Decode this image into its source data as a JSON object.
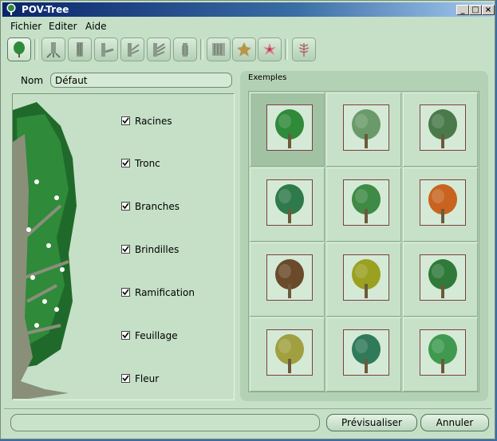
{
  "window": {
    "title": "POV-Tree"
  },
  "title_buttons": {
    "minimize": "_",
    "maximize": "□",
    "close": "×"
  },
  "menu": [
    {
      "label": "Fichier"
    },
    {
      "label": "Editer"
    },
    {
      "label": "Aide"
    }
  ],
  "toolbar": {
    "buttons": [
      {
        "icon": "tree-icon",
        "selected": true
      },
      {
        "icon": "roots-icon"
      },
      {
        "icon": "trunk-icon"
      },
      {
        "icon": "branches-icon"
      },
      {
        "icon": "twigs-icon"
      },
      {
        "icon": "ramification-icon"
      },
      {
        "icon": "trunk-texture-icon"
      },
      {
        "icon": "bark-icon"
      },
      {
        "icon": "leaf-icon"
      },
      {
        "icon": "flower-icon"
      },
      {
        "icon": "fern-icon"
      }
    ]
  },
  "name": {
    "label": "Nom",
    "value": "Défaut"
  },
  "components": [
    {
      "label": "Racines",
      "checked": true
    },
    {
      "label": "Tronc",
      "checked": true
    },
    {
      "label": "Branches",
      "checked": true
    },
    {
      "label": "Brindilles",
      "checked": true
    },
    {
      "label": "Ramification",
      "checked": true
    },
    {
      "label": "Feuillage",
      "checked": true
    },
    {
      "label": "Fleur",
      "checked": true
    }
  ],
  "examples": {
    "title": "Exemples",
    "items": [
      {
        "name": "example-tree-1",
        "selected": true,
        "color": "#2f8a3a"
      },
      {
        "name": "example-tree-2",
        "color": "#6a9a6a"
      },
      {
        "name": "example-tree-3",
        "color": "#4a7a4a"
      },
      {
        "name": "example-tree-4",
        "color": "#2f7a4a"
      },
      {
        "name": "example-tree-5",
        "color": "#3f8a44"
      },
      {
        "name": "example-tree-6",
        "color": "#c86420"
      },
      {
        "name": "example-tree-7",
        "color": "#6a4a2a"
      },
      {
        "name": "example-tree-8",
        "color": "#9aa020"
      },
      {
        "name": "example-tree-9",
        "color": "#2f7a3a"
      },
      {
        "name": "example-tree-10",
        "color": "#a0a040"
      },
      {
        "name": "example-tree-11",
        "color": "#2f7a5a"
      },
      {
        "name": "example-tree-12",
        "color": "#3f9a50"
      }
    ]
  },
  "status": {
    "text": ""
  },
  "buttons": {
    "preview": "Prévisualiser",
    "cancel": "Annuler"
  }
}
